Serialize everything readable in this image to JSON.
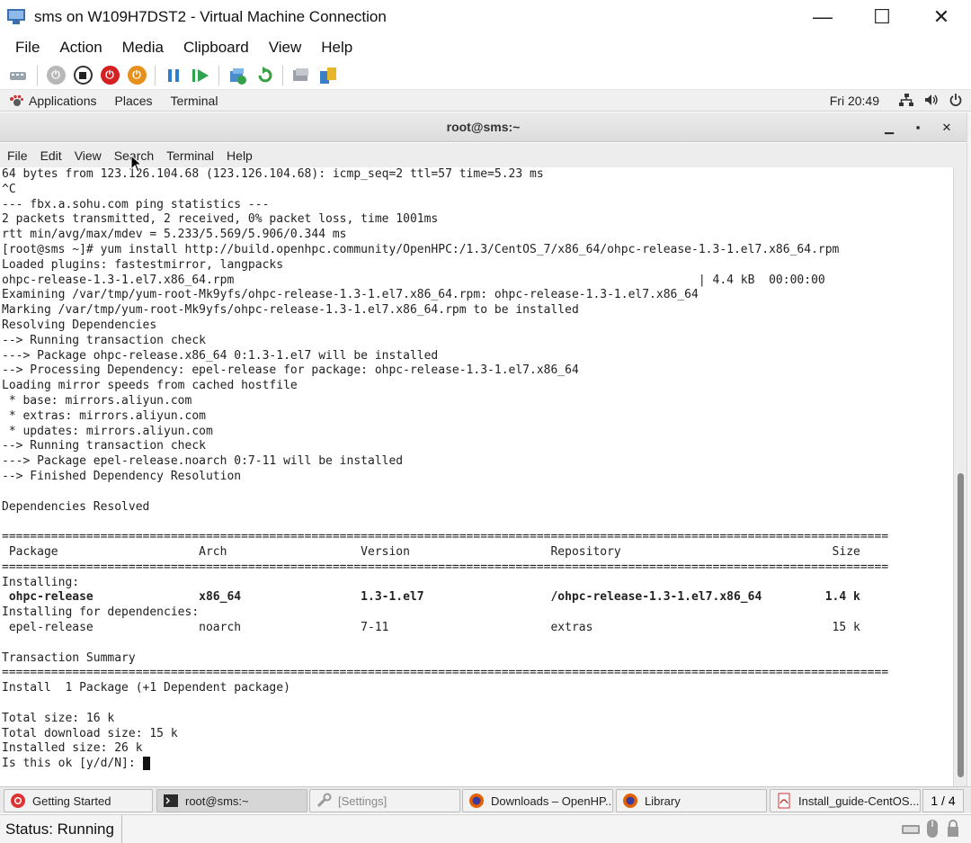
{
  "window": {
    "title": "sms on W109H7DST2 - Virtual Machine Connection",
    "minimize": "—",
    "maximize": "☐",
    "close": "✕"
  },
  "vm_menu": [
    "File",
    "Action",
    "Media",
    "Clipboard",
    "View",
    "Help"
  ],
  "toolbar_icons": [
    "ctrl-alt-del-icon",
    "start-icon",
    "turn-off-icon",
    "shut-down-icon",
    "save-icon",
    "pause-icon",
    "resume-icon",
    "checkpoint-icon",
    "revert-icon",
    "enhanced-session-icon",
    "share-icon"
  ],
  "gnome": {
    "applications": "Applications",
    "places": "Places",
    "terminal": "Terminal",
    "clock": "Fri 20:49"
  },
  "terminal": {
    "title": "root@sms:~",
    "menu": [
      "File",
      "Edit",
      "View",
      "Search",
      "Terminal",
      "Help"
    ],
    "lines": [
      "64 bytes from 123.126.104.68 (123.126.104.68): icmp_seq=2 ttl=57 time=5.23 ms",
      "^C",
      "--- fbx.a.sohu.com ping statistics ---",
      "2 packets transmitted, 2 received, 0% packet loss, time 1001ms",
      "rtt min/avg/max/mdev = 5.233/5.569/5.906/0.344 ms",
      "[root@sms ~]# yum install http://build.openhpc.community/OpenHPC:/1.3/CentOS_7/x86_64/ohpc-release-1.3-1.el7.x86_64.rpm",
      "Loaded plugins: fastestmirror, langpacks",
      "ohpc-release-1.3-1.el7.x86_64.rpm                                                                  | 4.4 kB  00:00:00",
      "Examining /var/tmp/yum-root-Mk9yfs/ohpc-release-1.3-1.el7.x86_64.rpm: ohpc-release-1.3-1.el7.x86_64",
      "Marking /var/tmp/yum-root-Mk9yfs/ohpc-release-1.3-1.el7.x86_64.rpm to be installed",
      "Resolving Dependencies",
      "--> Running transaction check",
      "---> Package ohpc-release.x86_64 0:1.3-1.el7 will be installed",
      "--> Processing Dependency: epel-release for package: ohpc-release-1.3-1.el7.x86_64",
      "Loading mirror speeds from cached hostfile",
      " * base: mirrors.aliyun.com",
      " * extras: mirrors.aliyun.com",
      " * updates: mirrors.aliyun.com",
      "--> Running transaction check",
      "---> Package epel-release.noarch 0:7-11 will be installed",
      "--> Finished Dependency Resolution",
      "",
      "Dependencies Resolved",
      "",
      "==============================================================================================================================",
      " Package                    Arch                   Version                    Repository                              Size",
      "==============================================================================================================================",
      "Installing:",
      " ohpc-release               x86_64                 1.3-1.el7                  /ohpc-release-1.3-1.el7.x86_64         1.4 k",
      "Installing for dependencies:",
      " epel-release               noarch                 7-11                       extras                                  15 k",
      "",
      "Transaction Summary",
      "==============================================================================================================================",
      "Install  1 Package (+1 Dependent package)",
      "",
      "Total size: 16 k",
      "Total download size: 15 k",
      "Installed size: 26 k",
      "Is this ok [y/d/N]: "
    ]
  },
  "taskbar": {
    "items": [
      {
        "label": "Getting Started",
        "icon": "help-icon"
      },
      {
        "label": "root@sms:~",
        "icon": "terminal-icon"
      },
      {
        "label": "[Settings]",
        "icon": "settings-icon"
      },
      {
        "label": "Downloads – OpenHP...",
        "icon": "firefox-icon"
      },
      {
        "label": "Library",
        "icon": "firefox-icon"
      },
      {
        "label": "Install_guide-CentOS...",
        "icon": "pdf-icon"
      }
    ],
    "pager": "1 / 4"
  },
  "status": {
    "text": "Status: Running"
  }
}
